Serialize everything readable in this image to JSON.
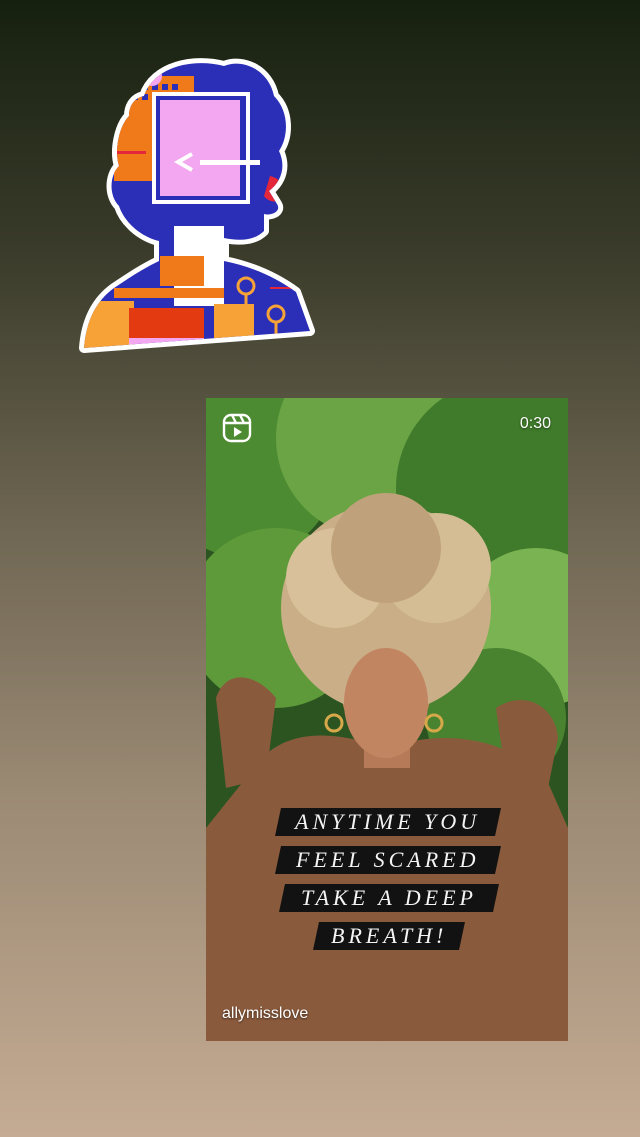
{
  "story": {
    "sticker": {
      "icon": "profile-silhouette-sticker"
    },
    "reel": {
      "icon": "reels-icon",
      "duration": "0:30",
      "username": "allymisslove",
      "caption_lines": [
        "ANYTIME YOU",
        "FEEL SCARED",
        "TAKE A DEEP",
        "BREATH!"
      ]
    }
  },
  "colors": {
    "gradient_top": "#16200f",
    "gradient_bottom": "#c5ab93",
    "sticker_blue": "#2b2fb8",
    "sticker_pink": "#f3a7f0",
    "sticker_orange": "#f07a1a"
  }
}
